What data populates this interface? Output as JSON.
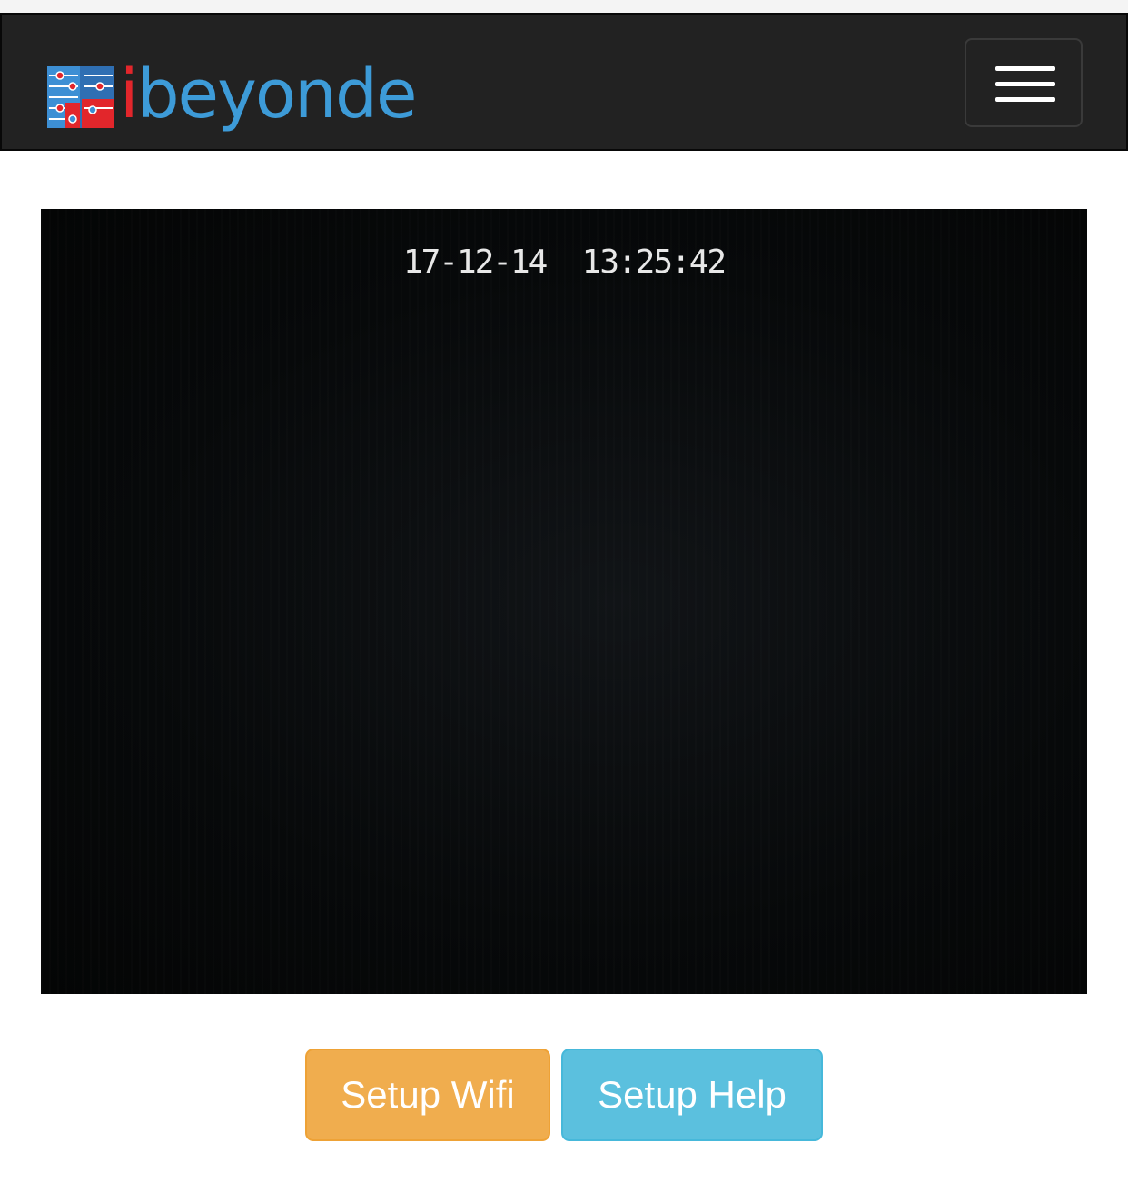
{
  "navbar": {
    "brand": {
      "first_letter": "i",
      "rest": "beyonde",
      "logo_icon": "circuit-board-logo"
    },
    "menu_icon": "hamburger-menu-icon"
  },
  "camera": {
    "timestamp": "17-12-14  13:25:42"
  },
  "actions": {
    "setup_wifi_label": "Setup Wifi",
    "setup_help_label": "Setup Help"
  },
  "colors": {
    "navbar_bg": "#222222",
    "brand_blue": "#3d9bd8",
    "brand_red": "#e2262b",
    "warning": "#f0ad4e",
    "info": "#5bc0de"
  }
}
